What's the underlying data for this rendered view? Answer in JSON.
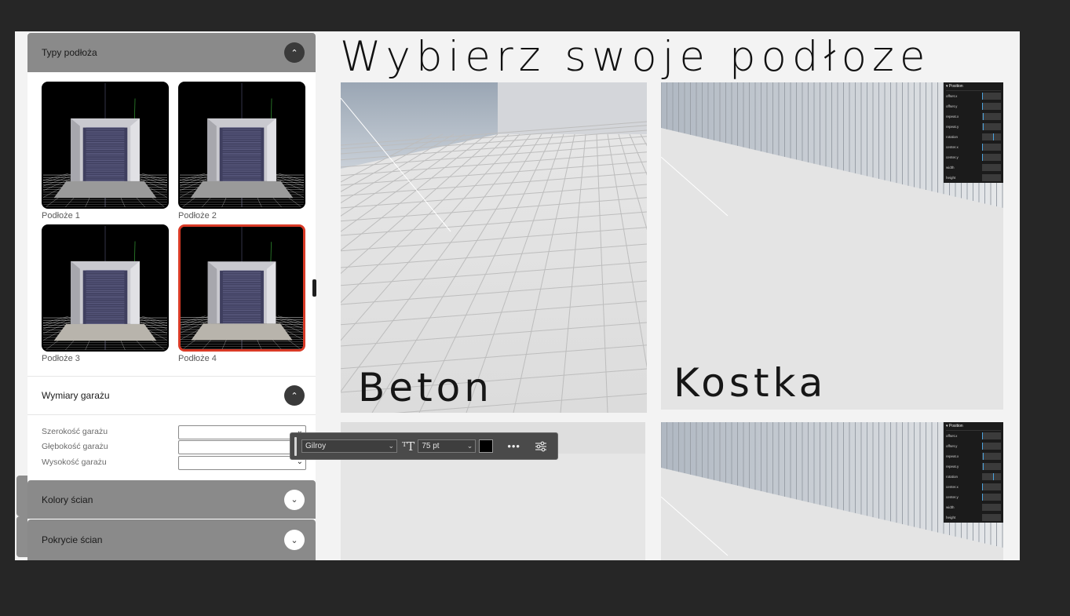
{
  "sidebar": {
    "section_types": {
      "title": "Typy podłoża",
      "toggle_icon": "chevron-up-icon"
    },
    "tiles": [
      {
        "label": "Podłoże 1",
        "selected": false
      },
      {
        "label": "Podłoże 2",
        "selected": false
      },
      {
        "label": "Podłoże 3",
        "selected": false
      },
      {
        "label": "Podłoże 4",
        "selected": true
      }
    ],
    "section_dimensions": {
      "title": "Wymiary garażu",
      "toggle_icon": "chevron-up-icon"
    },
    "dimensions": [
      {
        "label": "Szerokość garażu",
        "value": ""
      },
      {
        "label": "Głębokość garażu",
        "value": ""
      },
      {
        "label": "Wysokość garażu",
        "value": ""
      }
    ],
    "section_wall_colors": {
      "title": "Kolory ścian",
      "toggle_icon": "chevron-down-icon"
    },
    "section_wall_cover": {
      "title": "Pokrycie ścian",
      "toggle_icon": "chevron-down-icon"
    },
    "accent_color": "#d93a26"
  },
  "main": {
    "title": "Wybierz swoje podłoze",
    "photos": [
      {
        "label": "Beton"
      },
      {
        "label": "Kostka"
      },
      {
        "label": ""
      },
      {
        "label": ""
      }
    ],
    "position_panel": {
      "header": "▾ Position",
      "rows": [
        {
          "label": "offset.x",
          "value": 0.0
        },
        {
          "label": "offset.y",
          "value": 0.0
        },
        {
          "label": "repeat.x",
          "value": 0.05
        },
        {
          "label": "repeat.y",
          "value": 0.05
        },
        {
          "label": "rotation",
          "value": 0.6
        },
        {
          "label": "center.x",
          "value": 0.0
        },
        {
          "label": "center.y",
          "value": 0.0
        },
        {
          "label": "width",
          "value": null
        },
        {
          "label": "height",
          "value": null
        }
      ]
    }
  },
  "toolbar": {
    "font_family": "Gilroy",
    "font_size": "75 pt",
    "text_color": "#000000",
    "more_label": "•••"
  }
}
